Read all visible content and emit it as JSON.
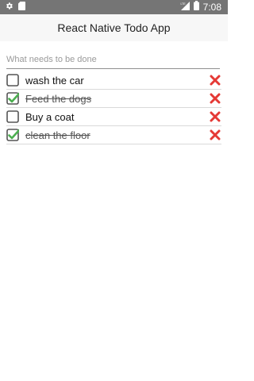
{
  "status_bar": {
    "time": "7:08",
    "network": "LTE",
    "icons": [
      "gear-icon",
      "sd-card-icon",
      "lte-signal-icon",
      "battery-icon"
    ]
  },
  "header": {
    "title": "React Native Todo App"
  },
  "input": {
    "placeholder": "What needs to be done",
    "value": ""
  },
  "todos": [
    {
      "text": "wash the car",
      "done": false
    },
    {
      "text": "Feed the dogs",
      "done": true
    },
    {
      "text": "Buy a coat",
      "done": false
    },
    {
      "text": "clean the floor",
      "done": true
    }
  ],
  "colors": {
    "check": "#4caf50",
    "delete": "#e53935"
  }
}
